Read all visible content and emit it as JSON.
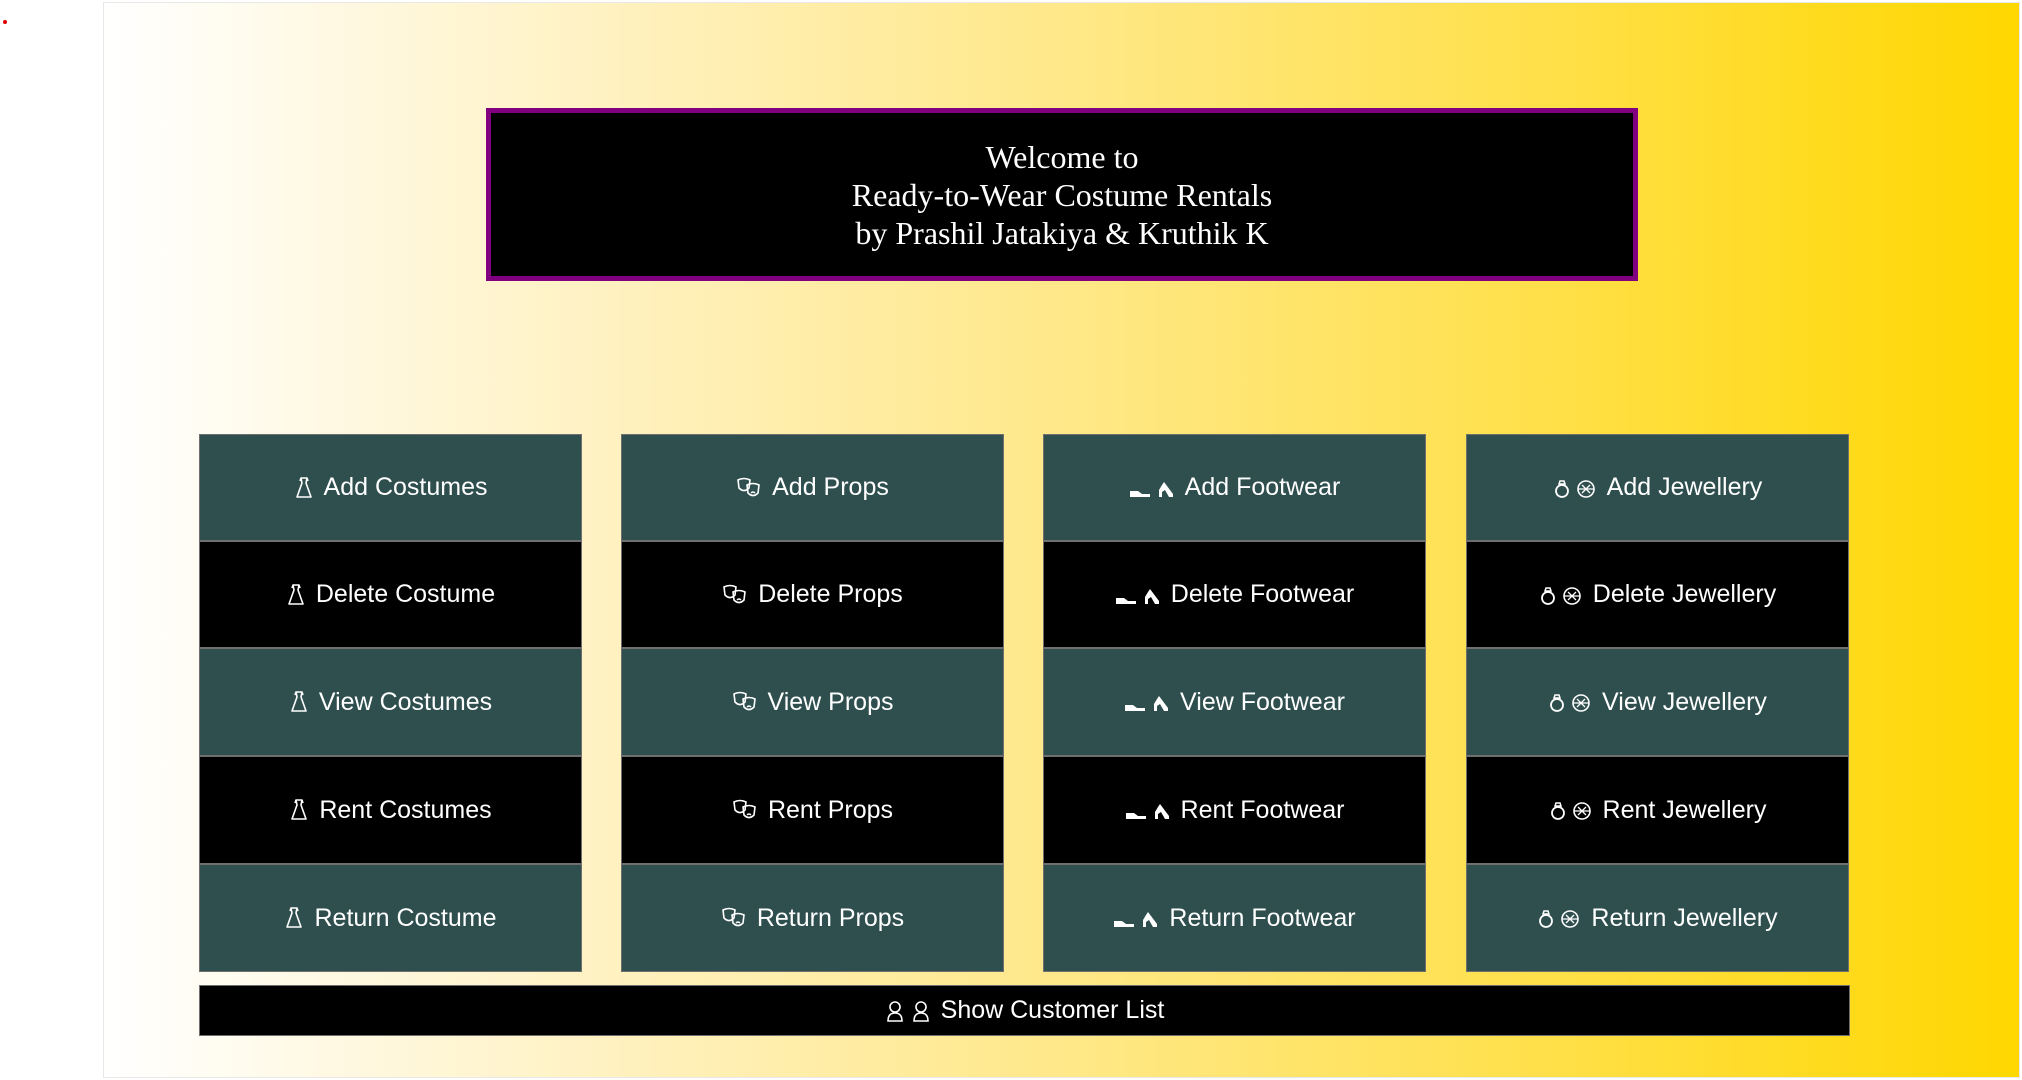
{
  "header": {
    "line1": "Welcome to",
    "line2": "Ready-to-Wear Costume Rentals",
    "line3": "by Prashil Jatakiya & Kruthik K"
  },
  "colors": {
    "header_border": "#800080",
    "button_teal": "#2f4f4f",
    "button_black": "#000000",
    "gradient_start": "#ffffff",
    "gradient_end": "#ffd700"
  },
  "icons": {
    "costumes": "dress-icon",
    "props": "theater-masks-icon",
    "footwear": "shoes-icon",
    "jewellery": "ring-and-gem-icon",
    "customers": "people-icon"
  },
  "buttons": {
    "costumes": {
      "add": "Add Costumes",
      "delete": "Delete Costume",
      "view": "View Costumes",
      "rent": "Rent Costumes",
      "return": "Return Costume"
    },
    "props": {
      "add": "Add Props",
      "delete": "Delete Props",
      "view": "View Props",
      "rent": "Rent Props",
      "return": "Return Props"
    },
    "footwear": {
      "add": "Add Footwear",
      "delete": "Delete Footwear",
      "view": "View Footwear",
      "rent": "Rent Footwear",
      "return": "Return Footwear"
    },
    "jewellery": {
      "add": "Add Jewellery",
      "delete": "Delete Jewellery",
      "view": "View Jewellery",
      "rent": "Rent Jewellery",
      "return": "Return Jewellery"
    }
  },
  "customers": {
    "show_label": "Show Customer List"
  }
}
